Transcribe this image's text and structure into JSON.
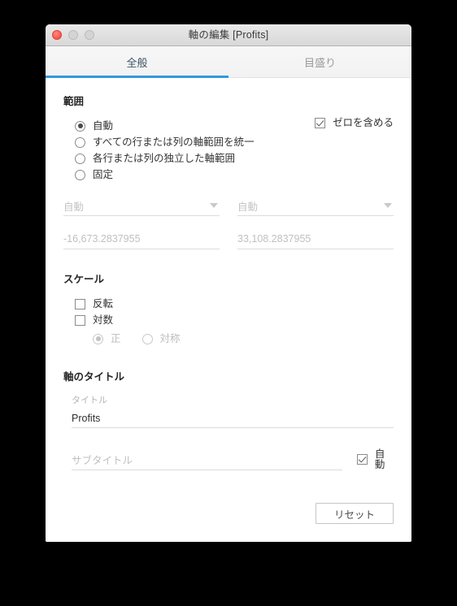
{
  "window": {
    "title": "軸の編集 [Profits]",
    "controls": {
      "close": "close-button",
      "minimize": "minimize-button",
      "maximize": "maximize-button"
    }
  },
  "tabs": [
    {
      "label": "全般",
      "active": true
    },
    {
      "label": "目盛り",
      "active": false
    }
  ],
  "range": {
    "heading": "範囲",
    "options": [
      {
        "label": "自動",
        "selected": true
      },
      {
        "label": "すべての行または列の軸範囲を統一",
        "selected": false
      },
      {
        "label": "各行または列の独立した軸範囲",
        "selected": false
      },
      {
        "label": "固定",
        "selected": false
      }
    ],
    "include_zero": {
      "label": "ゼロを含める",
      "checked": true
    },
    "start": {
      "dropdown_value": "自動",
      "value": "-16,673.2837955"
    },
    "end": {
      "dropdown_value": "自動",
      "value": "33,108.2837955"
    }
  },
  "scale": {
    "heading": "スケール",
    "reverse": {
      "label": "反転",
      "checked": false
    },
    "logarithmic": {
      "label": "対数",
      "checked": false
    },
    "log_modes": [
      {
        "label": "正",
        "selected": true,
        "disabled": true
      },
      {
        "label": "対称",
        "selected": false,
        "disabled": true
      }
    ]
  },
  "axis_title": {
    "heading": "軸のタイトル",
    "title_caption": "タイトル",
    "title_value": "Profits",
    "subtitle_placeholder": "サブタイトル",
    "subtitle_auto": {
      "label": "自動",
      "checked": true
    }
  },
  "footer": {
    "reset_label": "リセット"
  },
  "colors": {
    "accent": "#3399dd",
    "close_button": "#fc5f57",
    "titlebar": "#e2e2e2",
    "text": "#333333",
    "disabled_text": "#c0c0c0"
  }
}
